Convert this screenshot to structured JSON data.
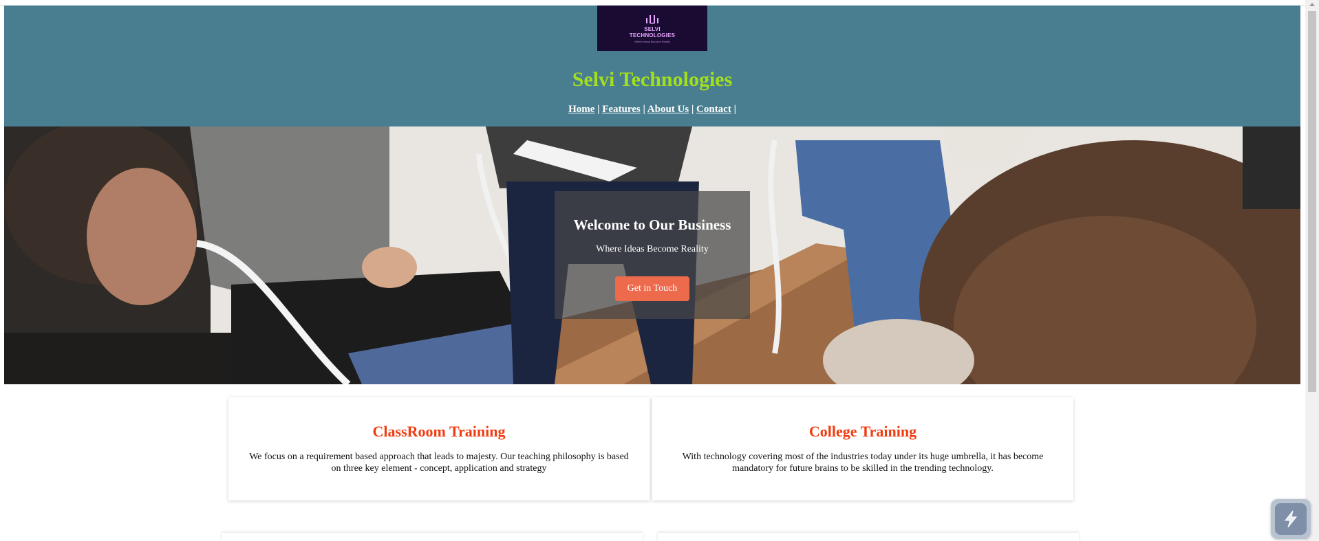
{
  "header": {
    "logo": {
      "name_line1": "SELVI",
      "name_line2": "TECHNOLOGIES",
      "tagline": "Where Ideas Become Reality"
    },
    "site_title": "Selvi Technologies",
    "nav": [
      {
        "label": "Home"
      },
      {
        "label": "Features"
      },
      {
        "label": "About Us"
      },
      {
        "label": "Contact"
      }
    ],
    "nav_separator": " | "
  },
  "hero": {
    "title": "Welcome to Our Business",
    "subtitle": "Where Ideas Become Reality",
    "button_label": "Get in Touch"
  },
  "cards": [
    {
      "title": "ClassRoom Training",
      "text": "We focus on a requirement based approach that leads to majesty. Our teaching philosophy is based on three key element - concept, application and strategy"
    },
    {
      "title": "College Training",
      "text": "With technology covering most of the industries today under its huge umbrella, it has become mandatory for future brains to be skilled in the trending technology."
    }
  ],
  "colors": {
    "header_bg": "#487e90",
    "title_green": "#a2df1d",
    "accent_orange": "#ed6a4d",
    "card_title_red": "#f03c10",
    "logo_bg": "#1a0b33"
  },
  "widget": {
    "icon": "lightning-bolt-icon"
  }
}
